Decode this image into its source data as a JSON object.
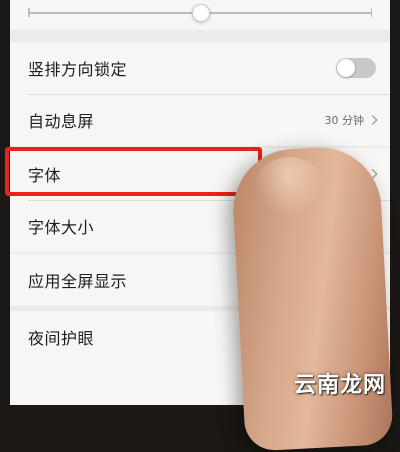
{
  "brightness": {
    "level": 0.5
  },
  "settings": {
    "portrait_lock": {
      "label": "竖排方向锁定",
      "enabled": false
    },
    "auto_sleep": {
      "label": "自动息屏",
      "value": "30 分钟"
    },
    "font": {
      "label": "字体"
    },
    "font_size": {
      "label": "字体大小"
    },
    "fullscreen_apps": {
      "label": "应用全屏显示"
    },
    "night_mode": {
      "label": "夜间护眼"
    }
  },
  "watermark": {
    "text": "云南龙网"
  },
  "colors": {
    "highlight": "#e8231f",
    "background": "#ecebe9"
  }
}
